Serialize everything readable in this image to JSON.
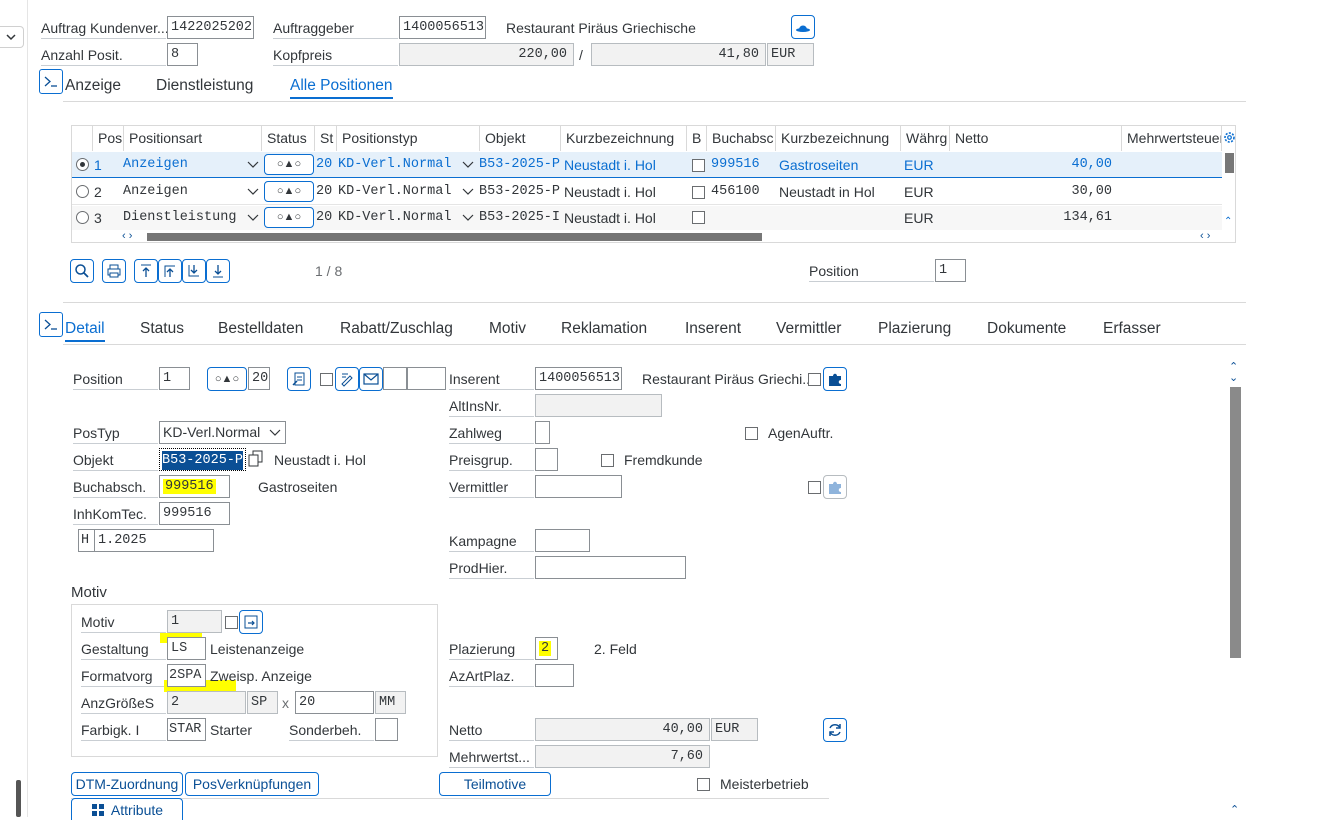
{
  "header": {
    "auftrag_label": "Auftrag Kundenver...",
    "auftrag_value": "1422025202",
    "auftraggeber_label": "Auftraggeber",
    "auftraggeber_value": "1400056513",
    "auftraggeber_name": "Restaurant Piräus Griechische",
    "anzahl_label": "Anzahl Posit.",
    "anzahl_value": "8",
    "kopfpreis_label": "Kopfpreis",
    "kopfpreis_value": "220,00",
    "slash": "/",
    "kopfpreis_value2": "41,80",
    "currency": "EUR"
  },
  "top_tabs": [
    {
      "label": "Anzeige"
    },
    {
      "label": "Dienstleistung"
    },
    {
      "label": "Alle Positionen"
    }
  ],
  "table": {
    "headers": [
      "Pos",
      "Positionsart",
      "Status",
      "St",
      "Positionstyp",
      "Objekt",
      "Kurzbezeichnung",
      "B",
      "Buchabsc",
      "Kurzbezeichnung",
      "Währg",
      "Netto",
      "Mehrwertsteuer"
    ],
    "rows": [
      {
        "pos": "1",
        "art": "Anzeigen",
        "st": "20",
        "typ": "KD-Verl.Normal",
        "objekt": "B53-2025-P",
        "kurz": "Neustadt i. Hol",
        "buch": "999516",
        "kurz2": "Gastroseiten",
        "waehrg": "EUR",
        "netto": "40,00"
      },
      {
        "pos": "2",
        "art": "Anzeigen",
        "st": "20",
        "typ": "KD-Verl.Normal",
        "objekt": "B53-2025-P",
        "kurz": "Neustadt i. Hol",
        "buch": "456100",
        "kurz2": "Neustadt in Hol",
        "waehrg": "EUR",
        "netto": "30,00"
      },
      {
        "pos": "3",
        "art": "Dienstleistung",
        "st": "20",
        "typ": "KD-Verl.Normal",
        "objekt": "B53-2025-I",
        "kurz": "Neustadt i. Hol",
        "buch": "",
        "kurz2": "",
        "waehrg": "EUR",
        "netto": "134,61"
      }
    ],
    "status_icon": "○▲○",
    "pager": "1 / 8",
    "position_label": "Position",
    "position_value": "1"
  },
  "detail_tabs": [
    {
      "label": "Detail"
    },
    {
      "label": "Status"
    },
    {
      "label": "Bestelldaten"
    },
    {
      "label": "Rabatt/Zuschlag"
    },
    {
      "label": "Motiv"
    },
    {
      "label": "Reklamation"
    },
    {
      "label": "Inserent"
    },
    {
      "label": "Vermittler"
    },
    {
      "label": "Plazierung"
    },
    {
      "label": "Dokumente"
    },
    {
      "label": "Erfasser"
    }
  ],
  "detail": {
    "position_label": "Position",
    "position_value": "1",
    "status_st": "20",
    "postyp_label": "PosTyp",
    "postyp_value": "KD-Verl.Normal",
    "objekt_label": "Objekt",
    "objekt_value": "B53-2025-P",
    "objekt_text": "Neustadt i. Hol",
    "buchabsch_label": "Buchabsch.",
    "buchabsch_value": "999516",
    "buchabsch_text": "Gastroseiten",
    "inhkom_label": "InhKomTec.",
    "inhkom_value": "999516",
    "h_value": "H",
    "date_value": "1.2025",
    "inserent_label": "Inserent",
    "inserent_value": "1400056513",
    "inserent_name": "Restaurant Piräus Griechi...",
    "altins_label": "AltInsNr.",
    "zahlweg_label": "Zahlweg",
    "agenauftr_label": "AgenAuftr.",
    "preisgrup_label": "Preisgrup.",
    "fremdkunde_label": "Fremdkunde",
    "vermittler_label": "Vermittler",
    "kampagne_label": "Kampagne",
    "prodhier_label": "ProdHier."
  },
  "motiv": {
    "section_title": "Motiv",
    "motiv_label": "Motiv",
    "motiv_value": "1",
    "gestaltung_label": "Gestaltung",
    "gestaltung_value": "LS",
    "gestaltung_text": "Leistenanzeige",
    "formatvorg_label": "Formatvorg",
    "formatvorg_value": "2SPA",
    "formatvorg_text": "Zweisp. Anzeige",
    "anzgroesse_label": "AnzGrößeS",
    "anzgroesse_value": "2",
    "unit1": "SP",
    "x": "x",
    "anzgroesse_value2": "20",
    "unit2": "MM",
    "farbigk_label": "Farbigk. I",
    "farbigk_value": "STAR",
    "farbigk_text": "Starter",
    "sonderbeh_label": "Sonderbeh."
  },
  "right": {
    "plazierung_label": "Plazierung",
    "plazierung_value": "2",
    "plazierung_text": "2. Feld",
    "azartplaz_label": "AzArtPlaz.",
    "netto_label": "Netto",
    "netto_value": "40,00",
    "netto_currency": "EUR",
    "mwst_label": "Mehrwertst...",
    "mwst_value": "7,60",
    "meisterbetrieb_label": "Meisterbetrieb"
  },
  "buttons": {
    "dtm": "DTM-Zuordnung",
    "posverk": "PosVerknüpfungen",
    "teilmotive": "Teilmotive",
    "attribute": "Attribute"
  },
  "colors": {
    "accent": "#0a6ed1",
    "highlight": "#ffff00"
  }
}
